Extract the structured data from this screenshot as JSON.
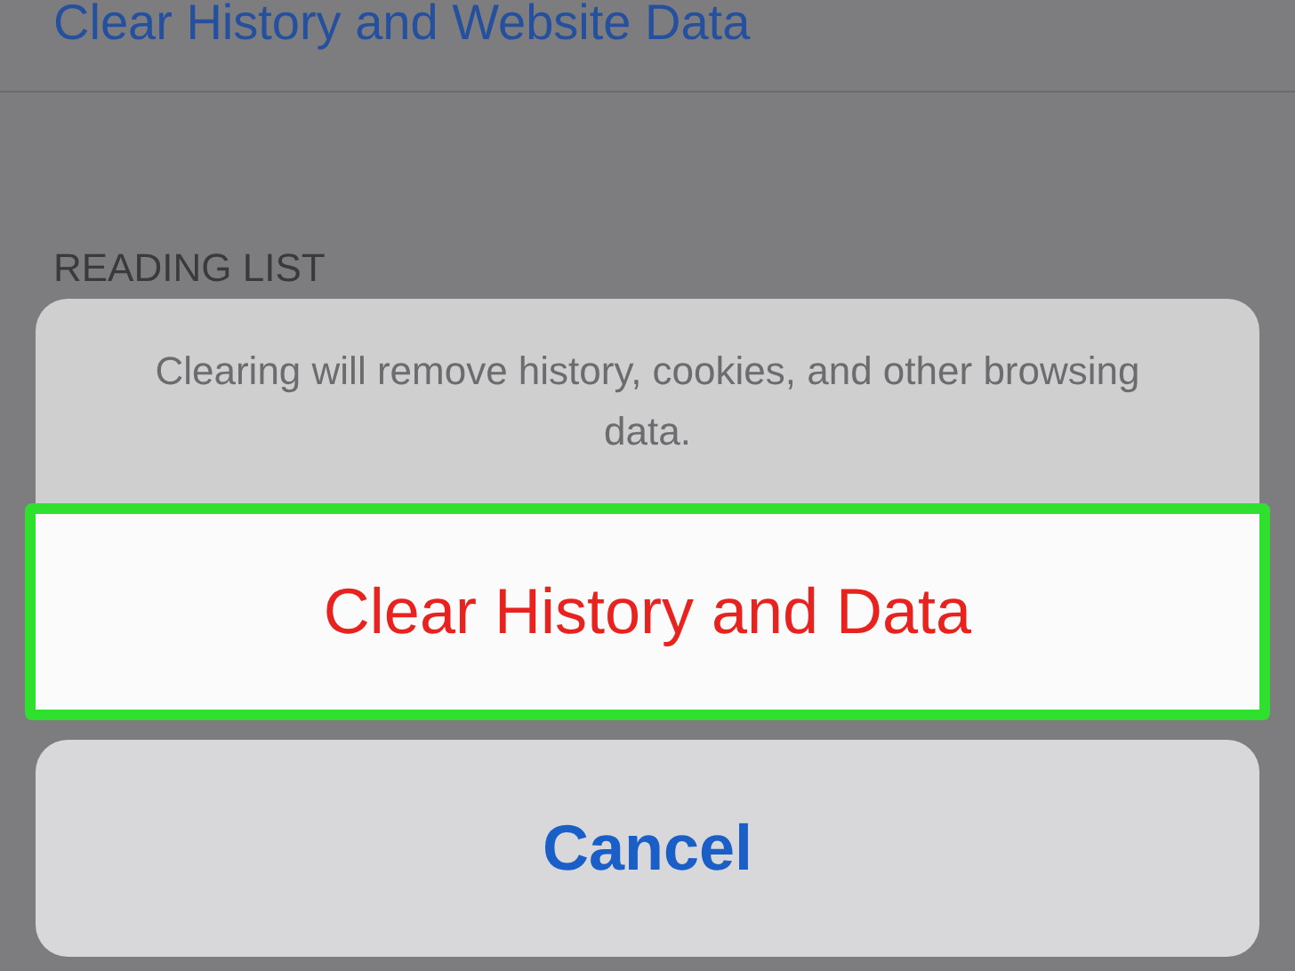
{
  "settings_row": {
    "label": "Clear History and Website Data"
  },
  "section_header": "READING LIST",
  "action_sheet": {
    "message": "Clearing will remove history, cookies, and other browsing data.",
    "actions": [
      {
        "label": "Clear History and Data",
        "kind": "destructive",
        "highlighted": true
      }
    ],
    "cancel": {
      "label": "Cancel"
    }
  }
}
